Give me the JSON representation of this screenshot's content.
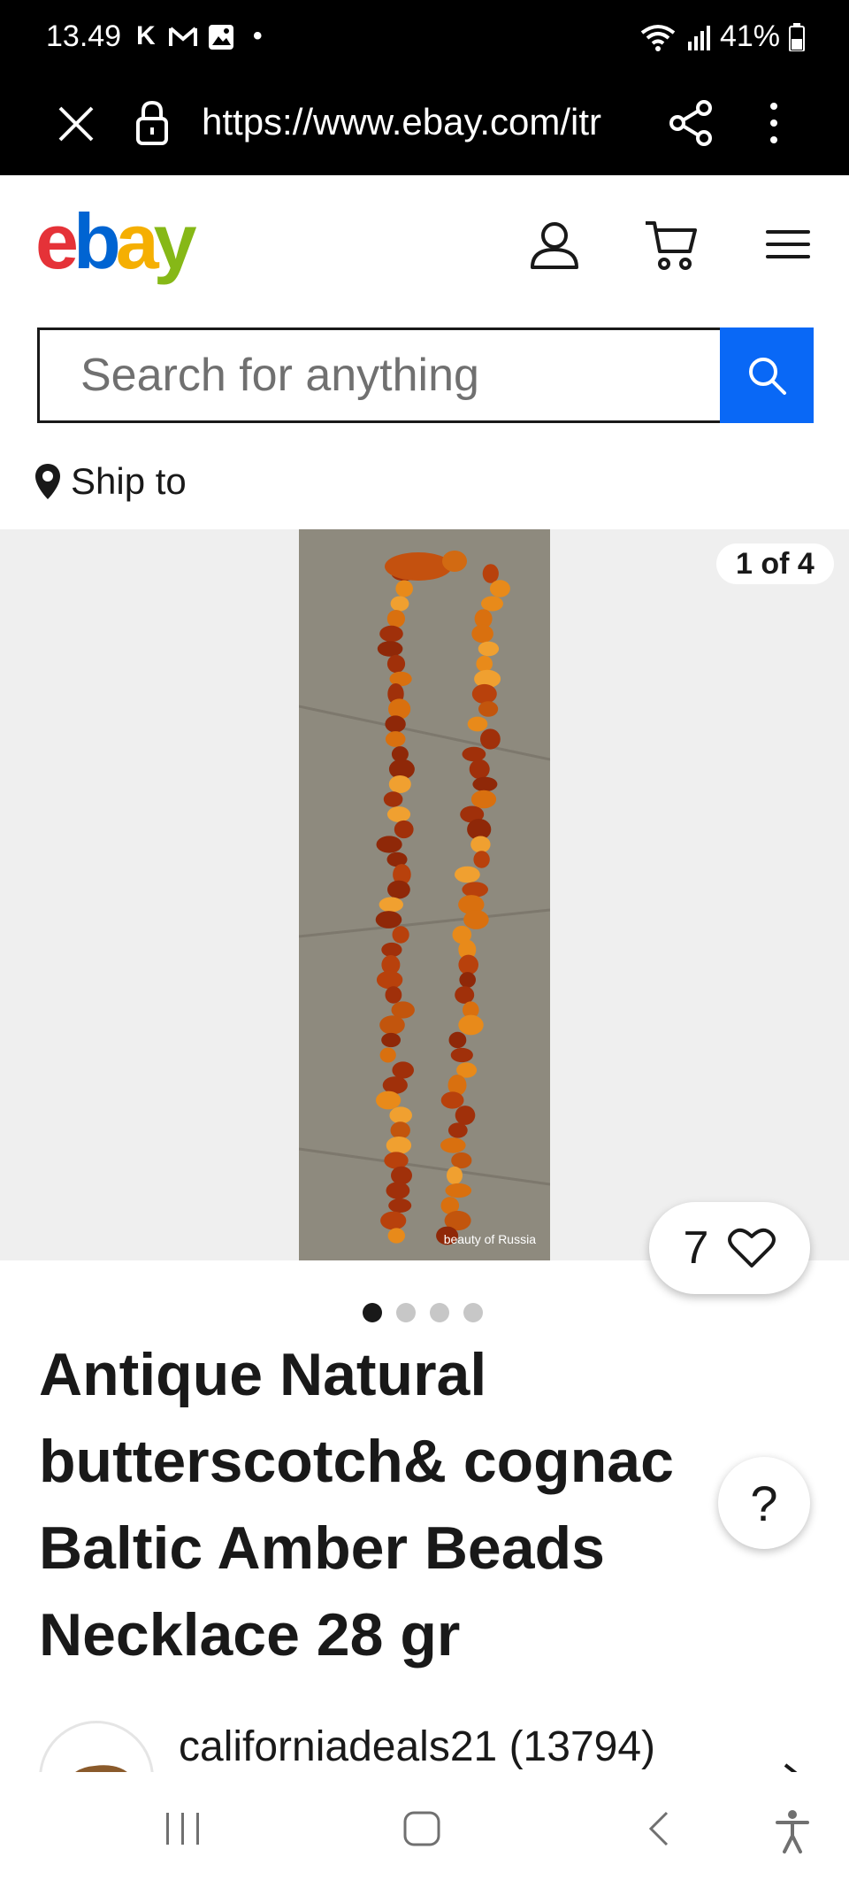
{
  "status_bar": {
    "time": "13.49",
    "notifications": [
      "K",
      "M",
      "image",
      "•"
    ],
    "battery": "41%"
  },
  "browser": {
    "url": "https://www.ebay.com/itr"
  },
  "header": {
    "logo": [
      "e",
      "b",
      "a",
      "y"
    ],
    "logo_colors": [
      "#e53238",
      "#0064d2",
      "#f5af02",
      "#86b817"
    ]
  },
  "search": {
    "placeholder": "Search for anything"
  },
  "ship_to": {
    "label": "Ship to"
  },
  "gallery": {
    "counter": "1 of 4",
    "watermark": "beauty of Russia",
    "watch_count": "7",
    "dots_total": 4,
    "dots_active": 1
  },
  "item": {
    "title": "Antique Natural butterscotch& cognac Baltic Amber Beads Necklace 28 gr"
  },
  "help": {
    "label": "?"
  },
  "seller": {
    "name": "californiadeals21 (13794)"
  },
  "colors": {
    "accent": "#0968f6",
    "text": "#191919"
  }
}
